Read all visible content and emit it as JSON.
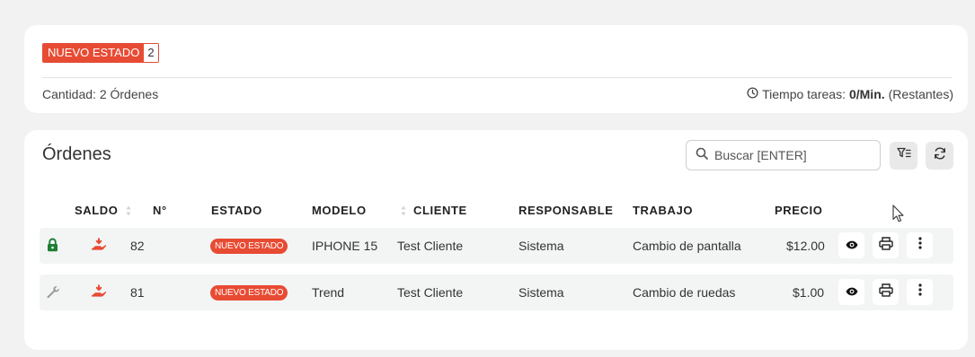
{
  "summary": {
    "status_label": "NUEVO ESTADO",
    "status_count": "2",
    "quantity_text": "Cantidad: 2 Órdenes",
    "time_prefix": "Tiempo tareas:",
    "time_value": "0/Min.",
    "time_suffix": "(Restantes)"
  },
  "orders": {
    "title": "Órdenes",
    "search_placeholder": "Buscar [ENTER]",
    "columns": [
      "SALDO",
      "N°",
      "ESTADO",
      "MODELO",
      "CLIENTE",
      "RESPONSABLE",
      "TRABAJO",
      "PRECIO"
    ],
    "rows": [
      {
        "status_icon": "lock-icon",
        "number": "82",
        "estado": "NUEVO ESTADO",
        "modelo": "IPHONE 15",
        "cliente": "Test Cliente",
        "responsable": "Sistema",
        "trabajo": "Cambio de pantalla",
        "precio": "$12.00"
      },
      {
        "status_icon": "wrench-icon",
        "number": "81",
        "estado": "NUEVO ESTADO",
        "modelo": "Trend",
        "cliente": "Test Cliente",
        "responsable": "Sistema",
        "trabajo": "Cambio de ruedas",
        "precio": "$1.00"
      }
    ]
  },
  "colors": {
    "accent_red": "#e84b33",
    "lock_green": "#1e7e34",
    "row_bg": "#f3f5f5"
  }
}
